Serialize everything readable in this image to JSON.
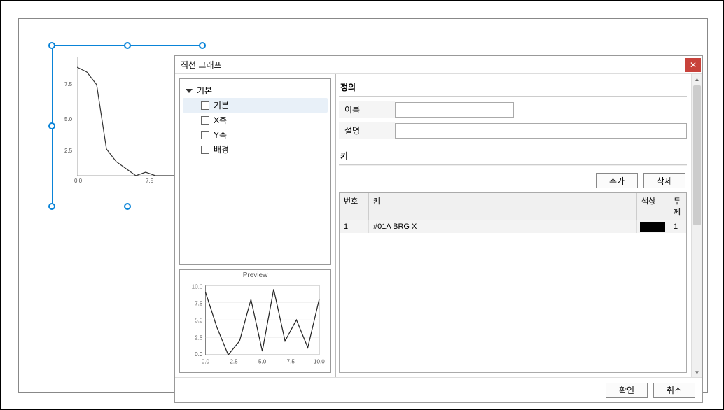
{
  "canvas": {
    "selected_chart": {
      "y_ticks": [
        "7.5",
        "5.0",
        "2.5"
      ],
      "x_ticks": [
        "0.0",
        "7.5"
      ]
    }
  },
  "dialog": {
    "title": "직선 그래프",
    "tree": {
      "root": "기본",
      "items": [
        {
          "label": "기본",
          "selected": true
        },
        {
          "label": "X축",
          "selected": false
        },
        {
          "label": "Y축",
          "selected": false
        },
        {
          "label": "배경",
          "selected": false
        }
      ]
    },
    "preview": {
      "title": "Preview",
      "y_ticks": [
        "10.0",
        "7.5",
        "5.0",
        "2.5",
        "0.0"
      ],
      "x_ticks": [
        "0.0",
        "2.5",
        "5.0",
        "7.5",
        "10.0"
      ]
    },
    "right": {
      "section_definition": "정의",
      "name_label": "이름",
      "name_value": "",
      "desc_label": "설명",
      "desc_value": "",
      "section_keys": "키",
      "add_label": "추가",
      "delete_label": "삭제",
      "columns": {
        "no": "번호",
        "key": "키",
        "color": "색상",
        "thickness": "두께"
      },
      "rows": [
        {
          "no": "1",
          "key": "#01A BRG X",
          "color": "#000000",
          "thickness": "1"
        }
      ]
    },
    "footer": {
      "ok": "확인",
      "cancel": "취소"
    }
  },
  "chart_data": [
    {
      "type": "line",
      "title": "",
      "xlabel": "",
      "ylabel": "",
      "xlim": [
        0,
        10
      ],
      "ylim": [
        0,
        10
      ],
      "x": [
        0,
        1,
        2,
        3,
        4,
        5,
        6,
        7,
        8,
        9,
        10
      ],
      "values": [
        9,
        8.5,
        7.5,
        2,
        1,
        0.5,
        0,
        0.3,
        0,
        0,
        0
      ],
      "context": "background selected chart"
    },
    {
      "type": "line",
      "title": "Preview",
      "xlabel": "",
      "ylabel": "",
      "xlim": [
        0,
        10
      ],
      "ylim": [
        0,
        10
      ],
      "x": [
        0,
        1,
        2,
        3,
        4,
        5,
        6,
        7,
        8,
        9,
        10
      ],
      "values": [
        9,
        4,
        0,
        2,
        8,
        0.5,
        9.5,
        2,
        5,
        1,
        8
      ],
      "context": "preview chart"
    }
  ]
}
